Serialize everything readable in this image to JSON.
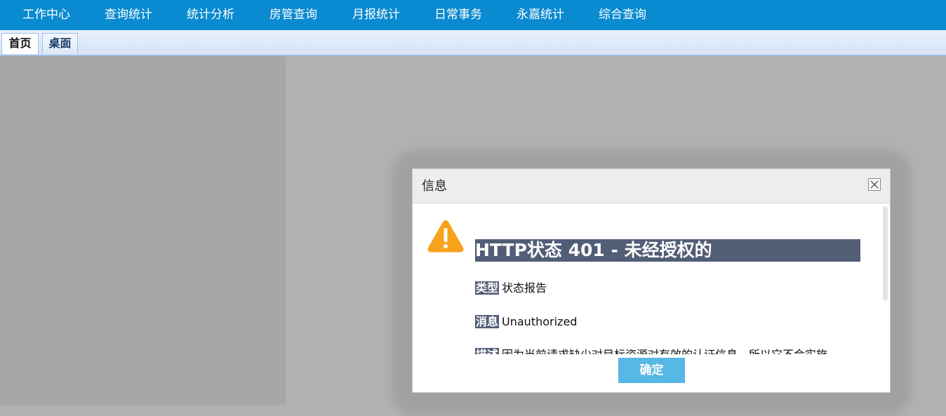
{
  "topnav": {
    "items": [
      "工作中心",
      "查询统计",
      "统计分析",
      "房管查询",
      "月报统计",
      "日常事务",
      "永嘉统计",
      "综合查询"
    ]
  },
  "tabs": [
    {
      "label": "首页",
      "active": true
    },
    {
      "label": "桌面",
      "active": false
    }
  ],
  "dialog": {
    "title": "信息",
    "close_icon": "close-icon",
    "warning_icon": "warning-icon",
    "error_title": "HTTP状态 401 - 未经授权的",
    "type_label": "类型",
    "type_value": "状态报告",
    "message_label": "消息",
    "message_value": "Unauthorized",
    "description_label": "描述",
    "description_value": "因为当前请求缺少对目标资源对有效的认证信息，所以它不会实施",
    "ok_label": "确定"
  },
  "colors": {
    "topnav_bg": "#0a8ad0",
    "error_title_bg": "#525d76",
    "warning": "#f7a21b",
    "ok_button": "#56b8e4"
  }
}
